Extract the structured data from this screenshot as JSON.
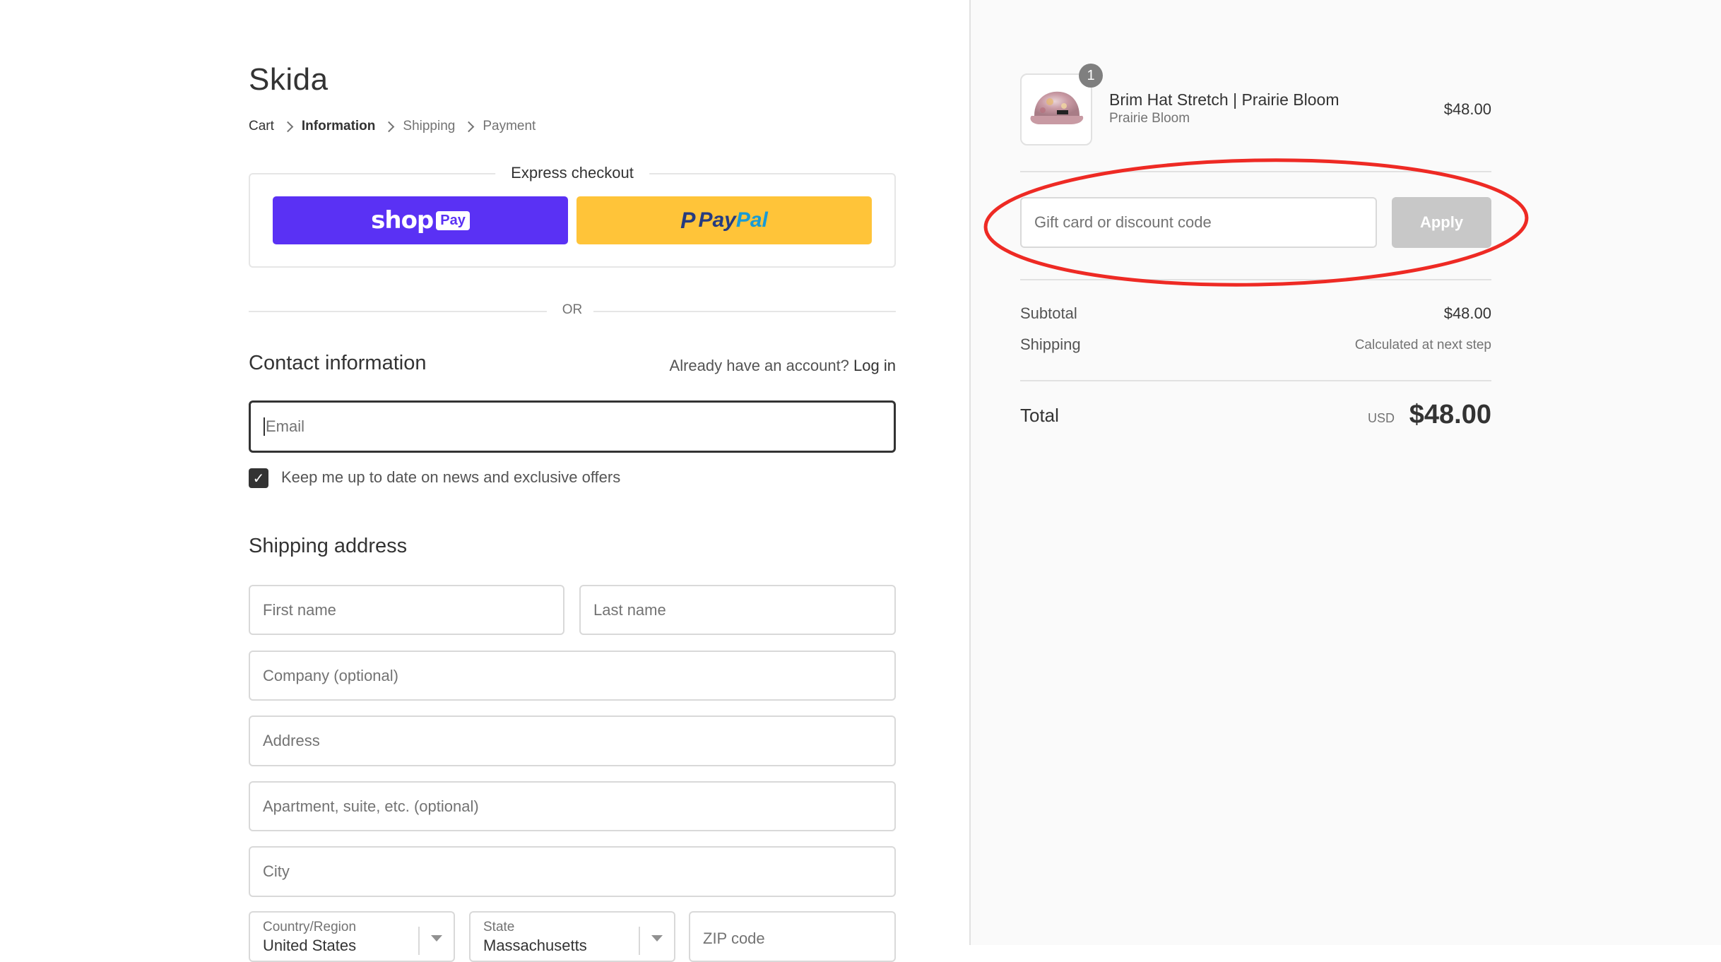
{
  "store": {
    "name": "Skida"
  },
  "breadcrumb": [
    {
      "label": "Cart",
      "state": "link"
    },
    {
      "label": "Information",
      "state": "current"
    },
    {
      "label": "Shipping",
      "state": "future"
    },
    {
      "label": "Payment",
      "state": "future"
    }
  ],
  "express": {
    "label": "Express checkout",
    "shoppay": {
      "word": "shop",
      "chip": "Pay",
      "color": "#5a31f4"
    },
    "paypal": {
      "pay": "Pay",
      "pal": "Pal",
      "color": "#ffc439"
    },
    "or_label": "OR"
  },
  "contact": {
    "heading": "Contact information",
    "account_prompt": "Already have an account?",
    "login_link": "Log in",
    "email_placeholder": "Email",
    "newsletter_label": "Keep me up to date on news and exclusive offers",
    "newsletter_checked": true
  },
  "shipping": {
    "heading": "Shipping address",
    "first_name_placeholder": "First name",
    "last_name_placeholder": "Last name",
    "company_placeholder": "Company (optional)",
    "address_placeholder": "Address",
    "apartment_placeholder": "Apartment, suite, etc. (optional)",
    "city_placeholder": "City",
    "country": {
      "label": "Country/Region",
      "value": "United States"
    },
    "state": {
      "label": "State",
      "value": "Massachusetts"
    },
    "zip_placeholder": "ZIP code"
  },
  "order": {
    "item": {
      "quantity": "1",
      "title": "Brim Hat Stretch | Prairie Bloom",
      "variant": "Prairie Bloom",
      "price": "$48.00"
    },
    "discount": {
      "placeholder": "Gift card or discount code",
      "apply_label": "Apply"
    },
    "subtotal_label": "Subtotal",
    "subtotal_value": "$48.00",
    "shipping_label": "Shipping",
    "shipping_value": "Calculated at next step",
    "total_label": "Total",
    "currency": "USD",
    "total_value": "$48.00"
  },
  "annotation": {
    "color": "#ee2a24",
    "target": "discount-code-section"
  }
}
